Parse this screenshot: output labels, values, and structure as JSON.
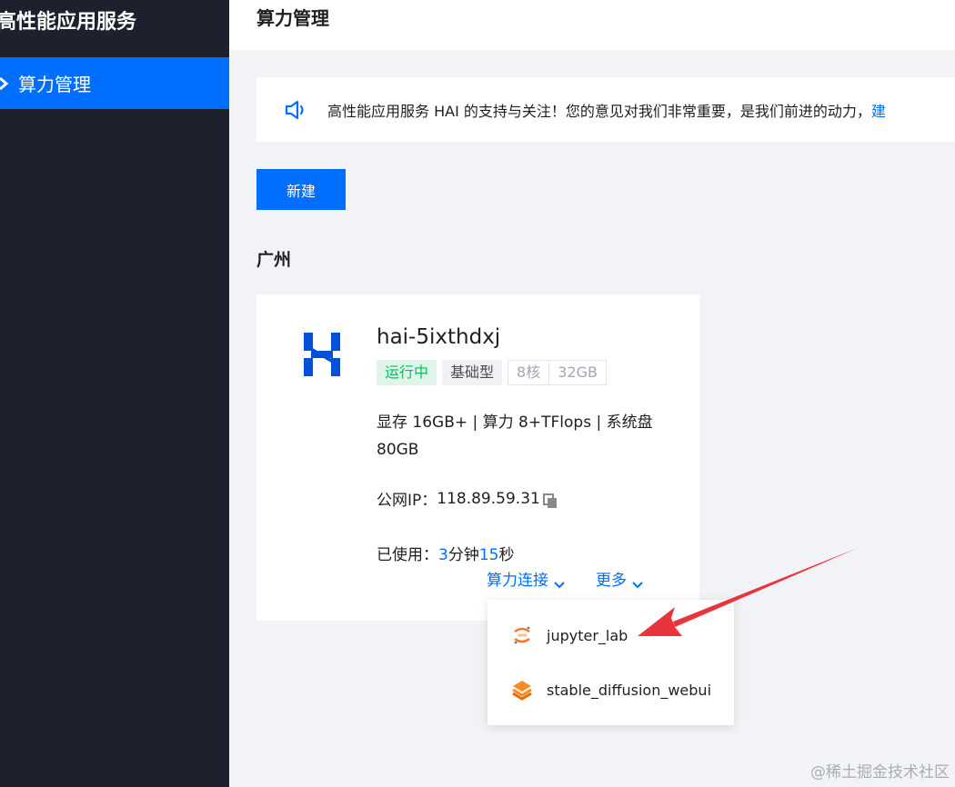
{
  "sidebar": {
    "title": "高性能应用服务",
    "items": [
      {
        "label": "算力管理",
        "icon": "gear-icon"
      }
    ],
    "background": "#1c212d",
    "active_color": "#006eff"
  },
  "header": {
    "title": "算力管理"
  },
  "notice": {
    "icon": "speaker-icon",
    "text": "高性能应用服务 HAI 的支持与关注！您的意见对我们非常重要，是我们前进的动力，",
    "link": "建"
  },
  "toolbar": {
    "new_label": "新建"
  },
  "region": {
    "title": "广州"
  },
  "instance": {
    "name": "hai-5ixthdxj",
    "status": "运行中",
    "type": "基础型",
    "cpu": "8核",
    "memory": "32GB",
    "specs": "显存 16GB+ | 算力 8+TFlops | 系统盘 80GB",
    "ip_label": "公网IP：",
    "ip": "118.89.59.31",
    "usage_label": "已使用：",
    "usage_minutes": "3",
    "usage_minutes_unit": "分钟",
    "usage_seconds": "15",
    "usage_seconds_unit": "秒",
    "connect_label": "算力连接",
    "more_label": "更多"
  },
  "dropdown": {
    "items": [
      {
        "label": "jupyter_lab",
        "icon": "jupyter-icon"
      },
      {
        "label": "stable_diffusion_webui",
        "icon": "stable-diffusion-icon"
      }
    ]
  },
  "watermark": "@稀土掘金技术社区",
  "colors": {
    "accent": "#006eff",
    "running": "#0abf5b",
    "arrow": "#e8343d"
  }
}
